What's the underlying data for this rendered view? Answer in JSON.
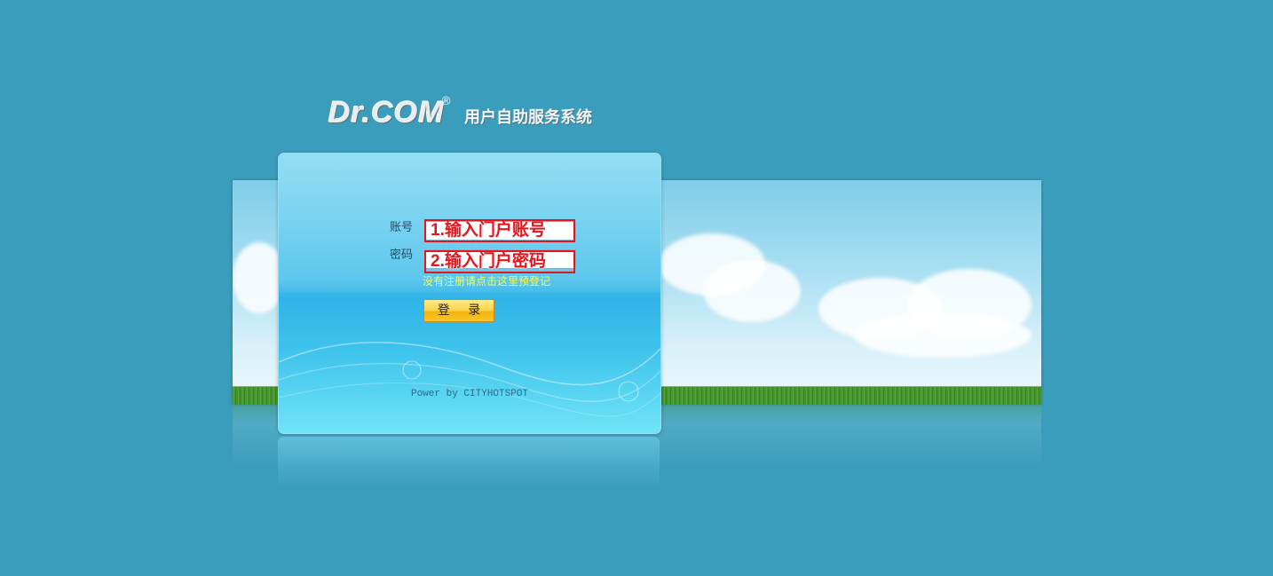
{
  "header": {
    "brand": "Dr.COM",
    "registered_mark": "®",
    "system_title": "用户自助服务系统"
  },
  "login": {
    "account_label": "账号",
    "password_label": "密码",
    "account_annotation": "1.输入门户账号",
    "password_annotation": "2.输入门户密码",
    "register_link": "没有注册请点击这里预登记",
    "login_button": "登 录",
    "powered_by": "Power by CITYHOTSPOT"
  },
  "colors": {
    "background": "#3b9dbc",
    "annotation_red": "#e8141c",
    "register_link": "#f1fb66",
    "button_gold": "#f4b40d"
  }
}
